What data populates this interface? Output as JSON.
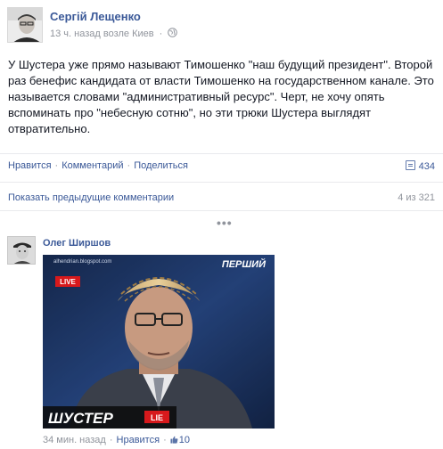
{
  "post": {
    "author": "Сергій Лещенко",
    "time": "13 ч. назад",
    "location": "возле Киев",
    "text": "У Шустера уже прямо называют Тимошенко \"наш будущий президент\". Второй раз бенефис кандидата от власти Тимошенко на государственном канале. Это называется словами \"административный ресурс\". Черт, не хочу опять вспоминать про \"небесную сотню\", но эти трюки Шустера выглядят отвратительно."
  },
  "actions": {
    "like": "Нравится",
    "comment": "Комментарий",
    "share": "Поделиться",
    "comment_count": "434"
  },
  "previous_comments": {
    "link": "Показать предыдущие комментарии",
    "count": "4 из 321"
  },
  "ellipsis": "•••",
  "comment": {
    "author": "Олег Ширшов",
    "photo": {
      "watermark": "alhendrian.blogspot.com",
      "live_badge": "LIVE",
      "channel": "ПЕРШИЙ",
      "show_logo": "ШУСТЕР",
      "show_badge": "LIE"
    },
    "time": "34 мин. назад",
    "like": "Нравится",
    "likes": "10"
  },
  "colors": {
    "link": "#3b5998",
    "meta": "#90949c",
    "text": "#141823"
  }
}
